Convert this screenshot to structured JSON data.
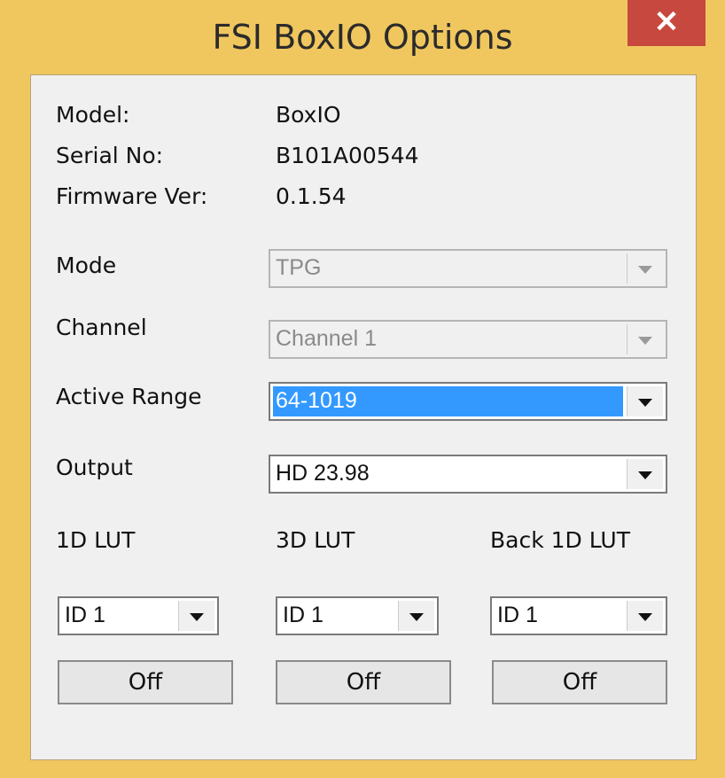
{
  "window": {
    "title": "FSI BoxIO Options",
    "close_glyph": "✕"
  },
  "device_info": {
    "model_label": "Model:",
    "model_value": "BoxIO",
    "serial_label": "Serial No:",
    "serial_value": "B101A00544",
    "firmware_label": "Firmware Ver:",
    "firmware_value": "0.1.54"
  },
  "settings": {
    "mode_label": "Mode",
    "mode_value": "TPG",
    "channel_label": "Channel",
    "channel_value": "Channel 1",
    "active_range_label": "Active Range",
    "active_range_value": "64-1019",
    "output_label": "Output",
    "output_value": "HD 23.98"
  },
  "luts": {
    "lut1d_label": "1D LUT",
    "lut1d_id": "ID 1",
    "lut1d_button": "Off",
    "lut3d_label": "3D LUT",
    "lut3d_id": "ID 1",
    "lut3d_button": "Off",
    "back1d_label": "Back 1D LUT",
    "back1d_id": "ID 1",
    "back1d_button": "Off"
  },
  "colors": {
    "frame": "#f0c75e",
    "close_button": "#c7483f",
    "selection": "#3399ff",
    "client": "#f0f0f0"
  }
}
